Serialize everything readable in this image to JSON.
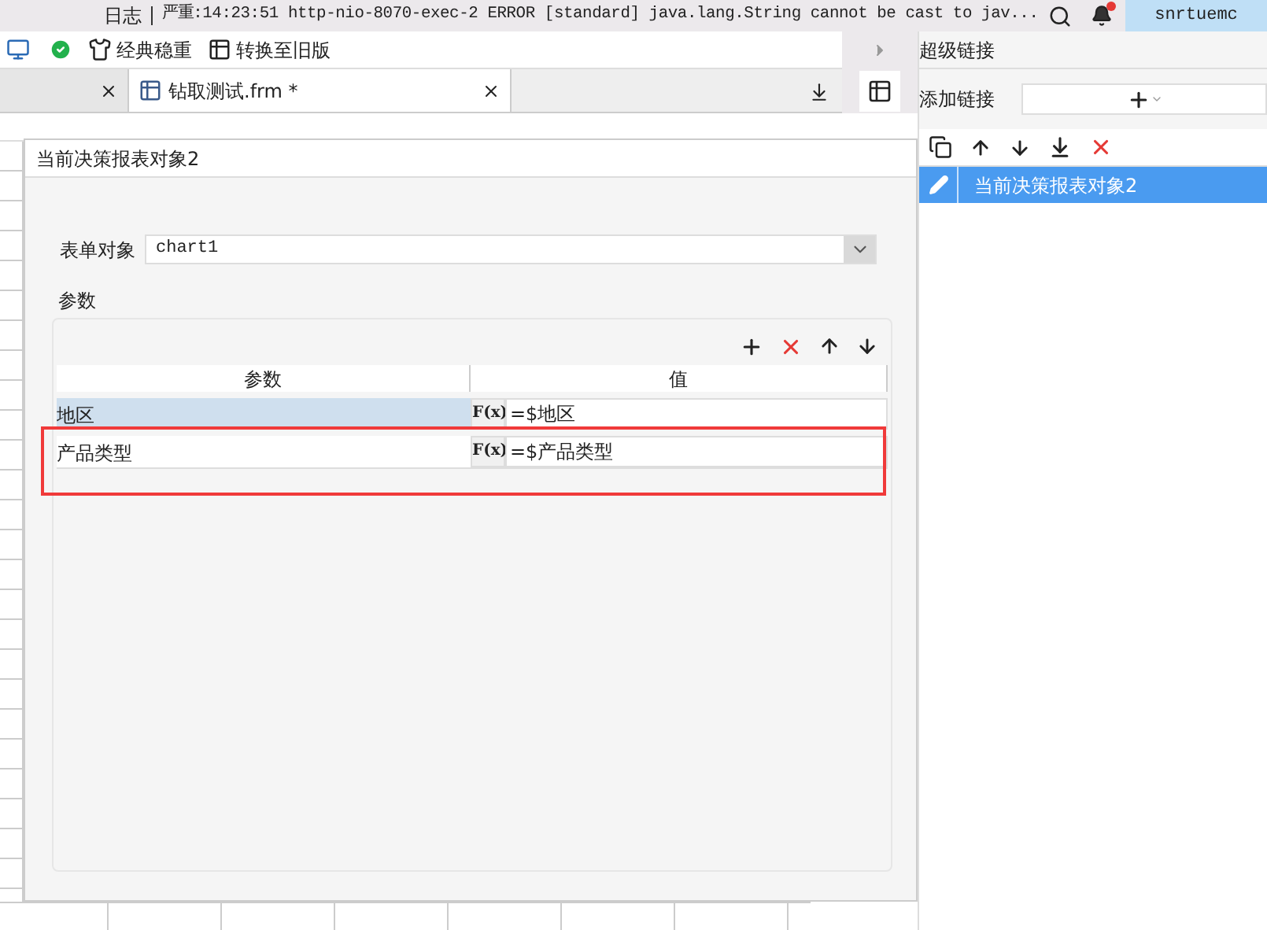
{
  "log_bar": {
    "label": "日志",
    "message": "严重:14:23:51 http-nio-8070-exec-2 ERROR [standard] java.lang.String cannot be cast to jav...",
    "has_alert": true,
    "user": "snrtuemc"
  },
  "toolbar": {
    "buttons": [
      {
        "label": "经典稳重"
      },
      {
        "label": "转换至旧版"
      }
    ]
  },
  "tabs": [
    {
      "selected": false
    },
    {
      "label": "钻取测试.frm *",
      "selected": true
    }
  ],
  "dialog": {
    "title": "当前决策报表对象2",
    "form_object": {
      "label": "表单对象",
      "value": "chart1"
    },
    "params": {
      "legend": "参数",
      "columns": [
        "参数",
        "值"
      ],
      "highlighted": true,
      "rows": [
        {
          "name": "地区",
          "formula_label": "F(x)",
          "value": "=$地区",
          "selected": true
        },
        {
          "name": "产品类型",
          "formula_label": "F(x)",
          "value": "=$产品类型",
          "selected": false
        }
      ]
    }
  },
  "hyperlink_panel": {
    "title": "超级链接",
    "add_label": "添加链接",
    "items": [
      {
        "label": "当前决策报表对象2",
        "selected": true
      }
    ]
  }
}
